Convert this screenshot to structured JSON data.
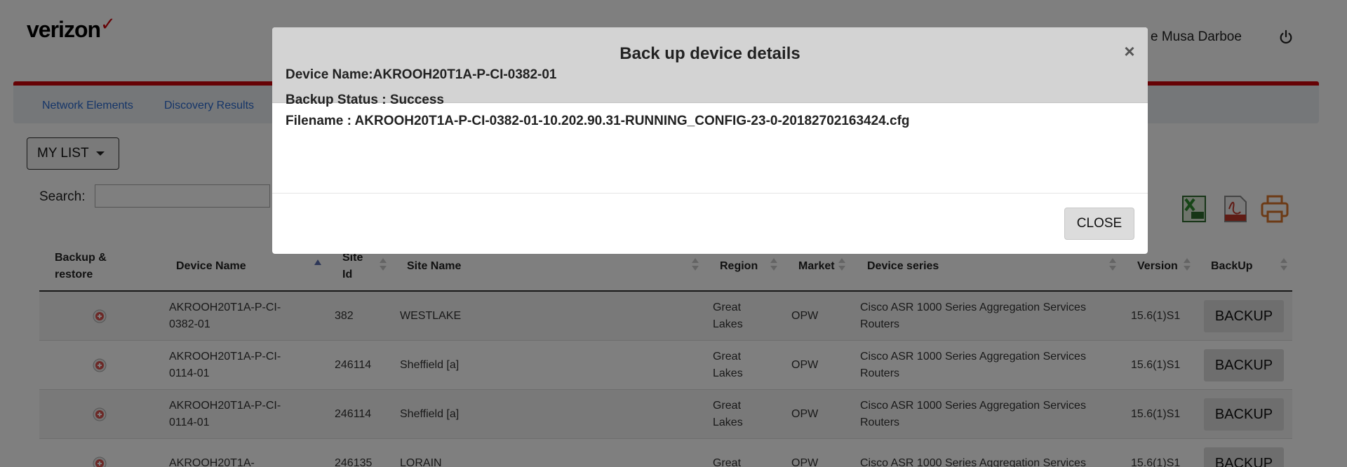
{
  "header": {
    "logo_text": "verizon",
    "logo_check": "✓",
    "user_name": "e Musa Darboe"
  },
  "nav": {
    "items": [
      {
        "label": "Network Elements"
      },
      {
        "label": "Discovery Results"
      }
    ]
  },
  "toolbar": {
    "my_list_label": "MY LIST",
    "search_label": "Search:",
    "search_value": ""
  },
  "table": {
    "columns": [
      "Backup & restore",
      "Device Name",
      "Site Id",
      "Site Name",
      "Region",
      "Market",
      "Device series",
      "Version",
      "BackUp"
    ],
    "rows": [
      {
        "device_name": "AKROOH20T1A-P-CI-0382-01",
        "site_id": "382",
        "site_name": "WESTLAKE",
        "region": "Great Lakes",
        "market": "OPW",
        "device_series": "Cisco ASR 1000 Series Aggregation Services Routers",
        "version": "15.6(1)S1",
        "backup_label": "BACKUP"
      },
      {
        "device_name": "AKROOH20T1A-P-CI-0114-01",
        "site_id": "246114",
        "site_name": "Sheffield [a]",
        "region": "Great Lakes",
        "market": "OPW",
        "device_series": "Cisco ASR 1000 Series Aggregation Services Routers",
        "version": "15.6(1)S1",
        "backup_label": "BACKUP"
      },
      {
        "device_name": "AKROOH20T1A-P-CI-0114-01",
        "site_id": "246114",
        "site_name": "Sheffield [a]",
        "region": "Great Lakes",
        "market": "OPW",
        "device_series": "Cisco ASR 1000 Series Aggregation Services Routers",
        "version": "15.6(1)S1",
        "backup_label": "BACKUP"
      },
      {
        "device_name": "AKROOH20T1A-",
        "site_id": "246135",
        "site_name": "LORAIN",
        "region": "Great",
        "market": "OPW",
        "device_series": "Cisco ASR 1000 Series Aggregation Services",
        "version": "15.6(1)S1",
        "backup_label": "BACKUP"
      }
    ]
  },
  "modal": {
    "title": "Back up device details",
    "device_label": "Device Name:AKROOH20T1A-P-CI-0382-01",
    "close_x": "×",
    "status_line": "Backup Status : Success",
    "filename_line": "Filename : AKROOH20T1A-P-CI-0382-01-10.202.90.31-RUNNING_CONFIG-23-0-20182702163424.cfg",
    "close_label": "CLOSE"
  },
  "icons": {
    "power": "power-icon",
    "excel": "excel-export-icon",
    "pdf": "pdf-export-icon",
    "print": "print-icon",
    "restore": "restore-icon"
  },
  "colors": {
    "brand_red": "#cd040b",
    "link_blue": "#2a6bd1",
    "modal_header_bg": "#d3d3d3",
    "overlay": "rgba(0,0,0,0.5)"
  }
}
